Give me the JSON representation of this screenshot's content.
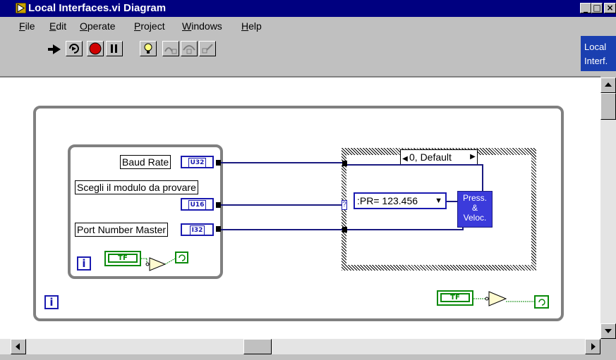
{
  "window": {
    "title": "Local Interfaces.vi Diagram",
    "controls": {
      "minimize": "_",
      "maximize": "□",
      "close": "×"
    }
  },
  "menu": [
    "File",
    "Edit",
    "Operate",
    "Project",
    "Windows",
    "Help"
  ],
  "toolbar": {
    "buttons": [
      "run-arrow-icon",
      "run-continuously-icon",
      "abort-icon",
      "pause-icon",
      "highlight-bulb-icon",
      "step-into-icon",
      "step-over-icon",
      "step-out-icon"
    ]
  },
  "side_label": {
    "line1": "Local",
    "line2": "Interf."
  },
  "diagram": {
    "terminals": [
      {
        "label": "Baud Rate",
        "type": "U32"
      },
      {
        "label": "Scegli il modulo da provare",
        "type": "U16"
      },
      {
        "label": "Port Number Master",
        "type": "I32"
      }
    ],
    "inner_iteration": "i",
    "outer_iteration": "i",
    "bool_label": "TF",
    "case_selector": "0, Default",
    "ring_value": ":PR= 123.456",
    "subvi": {
      "line1": "Press.",
      "line2": "&",
      "line3": "Veloc."
    },
    "selector_tunnel": "?"
  }
}
